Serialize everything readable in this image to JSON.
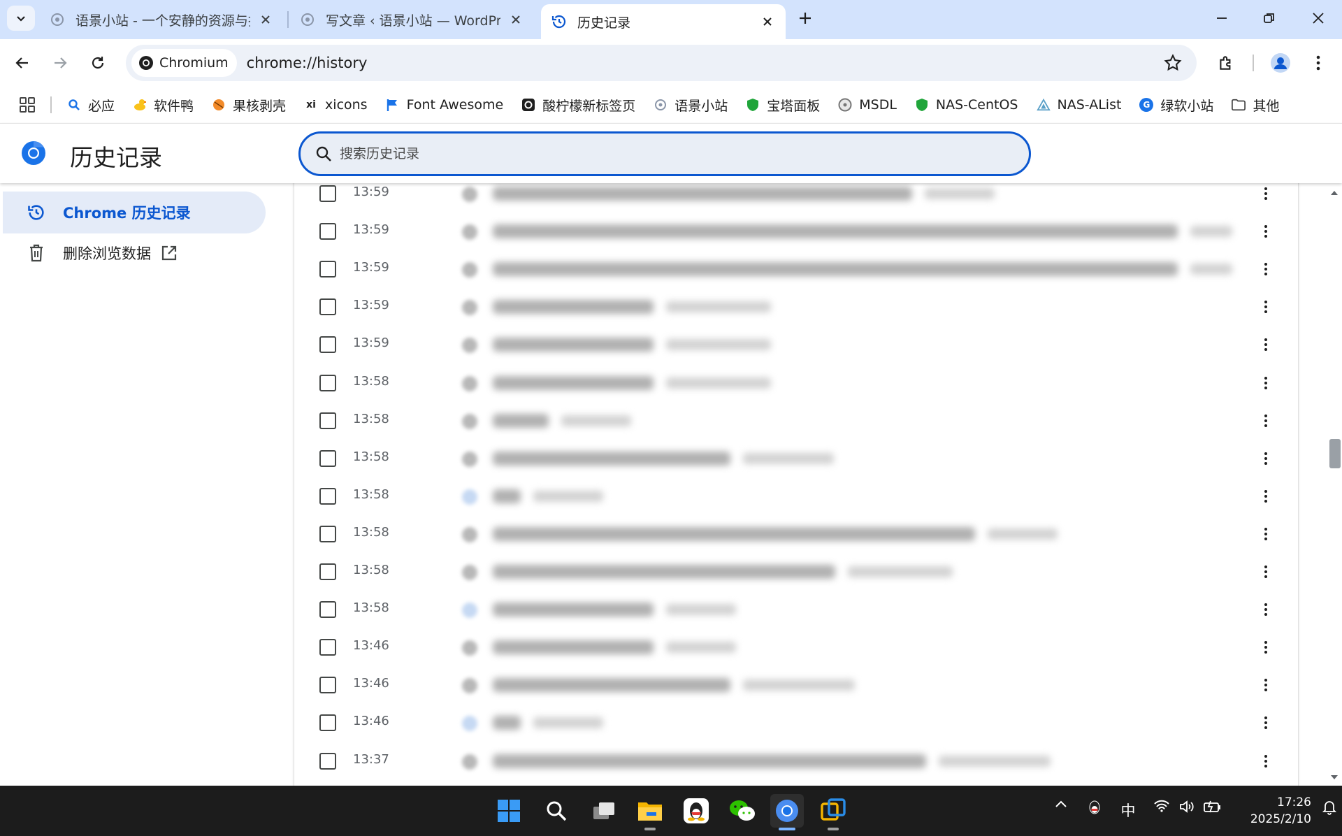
{
  "tabs": [
    {
      "title": "语景小站 - 一个安静的资源与技",
      "active": false
    },
    {
      "title": "写文章 ‹ 语景小站 — WordPre",
      "active": false
    },
    {
      "title": "历史记录",
      "active": true
    }
  ],
  "omnibox": {
    "chip_label": "Chromium",
    "url": "chrome://history"
  },
  "bookmarks": [
    {
      "label": "必应",
      "icon": "search-icon"
    },
    {
      "label": "软件鸭",
      "icon": "duck-icon"
    },
    {
      "label": "果核剥壳",
      "icon": "fruit-icon"
    },
    {
      "label": "xicons",
      "icon": "xi-icon"
    },
    {
      "label": "Font Awesome",
      "icon": "flag-icon"
    },
    {
      "label": "酸柠檬新标签页",
      "icon": "lemon-icon"
    },
    {
      "label": "语景小站",
      "icon": "gear-icon"
    },
    {
      "label": "宝塔面板",
      "icon": "shield-icon"
    },
    {
      "label": "MSDL",
      "icon": "disc-icon"
    },
    {
      "label": "NAS-CentOS",
      "icon": "shield-icon"
    },
    {
      "label": "NAS-AList",
      "icon": "alist-icon"
    },
    {
      "label": "绿软小站",
      "icon": "g-icon"
    },
    {
      "label": "其他",
      "icon": "folder-icon"
    }
  ],
  "history": {
    "page_title": "历史记录",
    "search_placeholder": "搜索历史记录",
    "sidebar": [
      {
        "label": "Chrome 历史记录",
        "selected": true
      },
      {
        "label": "删除浏览数据",
        "selected": false
      }
    ],
    "rows": [
      {
        "time": "13:59"
      },
      {
        "time": "13:59"
      },
      {
        "time": "13:59"
      },
      {
        "time": "13:59"
      },
      {
        "time": "13:59"
      },
      {
        "time": "13:58"
      },
      {
        "time": "13:58"
      },
      {
        "time": "13:58"
      },
      {
        "time": "13:58"
      },
      {
        "time": "13:58"
      },
      {
        "time": "13:58"
      },
      {
        "time": "13:58"
      },
      {
        "time": "13:46"
      },
      {
        "time": "13:46"
      },
      {
        "time": "13:46"
      },
      {
        "time": "13:37"
      }
    ]
  },
  "taskbar": {
    "ime": "中",
    "time": "17:26",
    "date": "2025/2/10"
  },
  "colors": {
    "accent": "#0b57d0",
    "tabstrip": "#d3e3fd",
    "taskbar": "#1c1c1c"
  }
}
